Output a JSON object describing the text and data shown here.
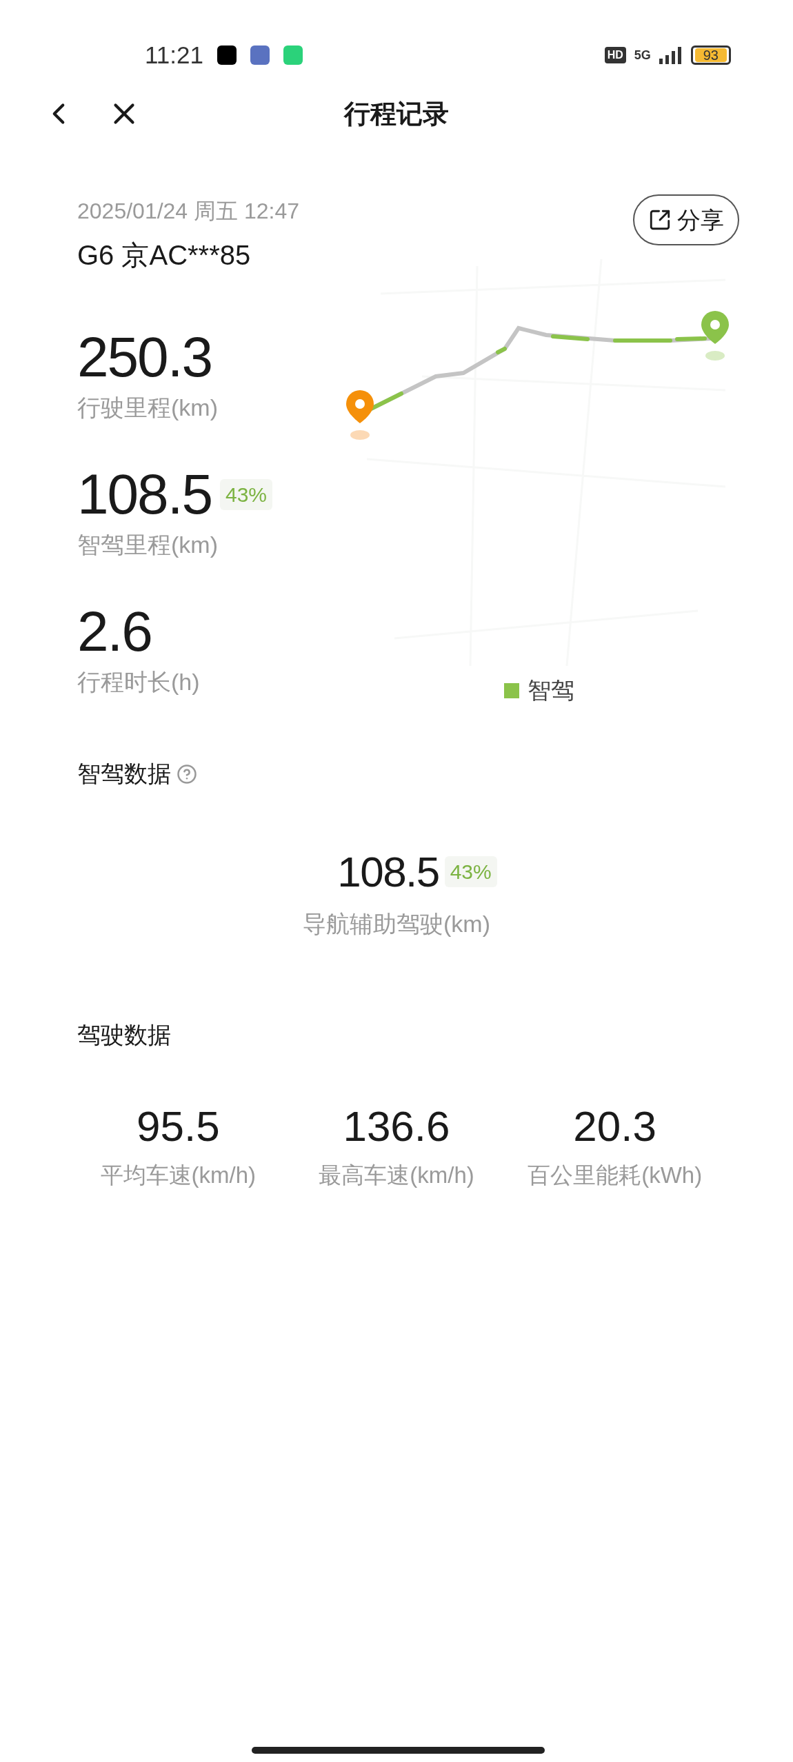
{
  "status_bar": {
    "time": "11:21",
    "hd": "HD",
    "network": "5G",
    "battery": "93"
  },
  "header": {
    "title": "行程记录"
  },
  "trip": {
    "datetime": "2025/01/24 周五 12:47",
    "vehicle": "G6 京AC***85",
    "share": "分享"
  },
  "stats": [
    {
      "value": "250.3",
      "label": "行驶里程(km)"
    },
    {
      "value": "108.5",
      "badge": "43%",
      "label": "智驾里程(km)"
    },
    {
      "value": "2.6",
      "label": "行程时长(h)"
    }
  ],
  "legend": {
    "label": "智驾",
    "color": "#8bc34a"
  },
  "smart_driving": {
    "title": "智驾数据",
    "value": "108.5",
    "badge": "43%",
    "label": "导航辅助驾驶(km)"
  },
  "driving_data": {
    "title": "驾驶数据",
    "items": [
      {
        "value": "95.5",
        "label": "平均车速(km/h)"
      },
      {
        "value": "136.6",
        "label": "最高车速(km/h)"
      },
      {
        "value": "20.3",
        "label": "百公里能耗(kWh)"
      }
    ]
  }
}
